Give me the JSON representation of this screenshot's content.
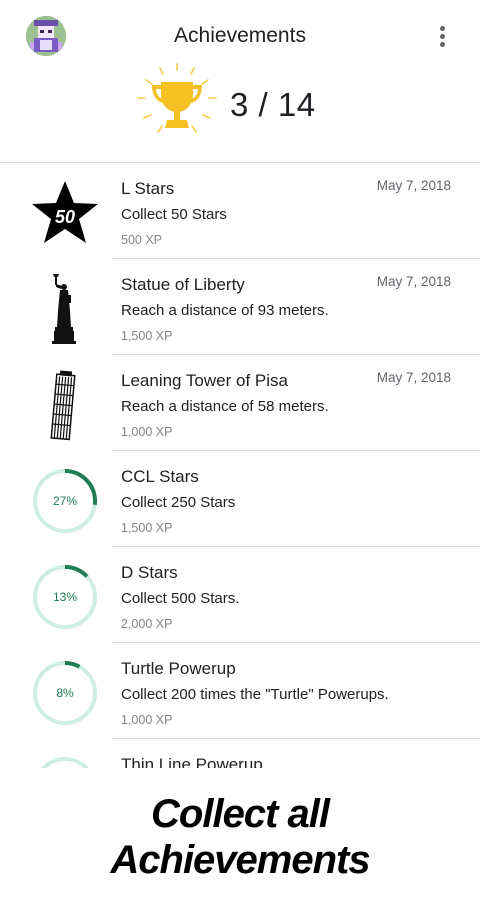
{
  "header": {
    "title": "Achievements",
    "menu_icon": "more-vert-icon",
    "avatar_icon": "avatar"
  },
  "summary": {
    "trophy_icon": "trophy-icon",
    "unlocked": 3,
    "total": 14,
    "text": "3 / 14",
    "accent_color": "#f7c531"
  },
  "achievements": [
    {
      "name": "L Stars",
      "description": "Collect 50 Stars",
      "xp": "500 XP",
      "date": "May 7, 2018",
      "state": "unlocked",
      "icon": "star-50-icon",
      "icon_text": "50"
    },
    {
      "name": "Statue of Liberty",
      "description": "Reach a distance of 93 meters.",
      "xp": "1,500 XP",
      "date": "May 7, 2018",
      "state": "unlocked",
      "icon": "statue-of-liberty-icon"
    },
    {
      "name": "Leaning Tower of Pisa",
      "description": "Reach a distance of 58 meters.",
      "xp": "1,000 XP",
      "date": "May 7, 2018",
      "state": "unlocked",
      "icon": "leaning-tower-icon"
    },
    {
      "name": "CCL Stars",
      "description": "Collect 250 Stars",
      "xp": "1,500 XP",
      "state": "in-progress",
      "progress": 0.27,
      "progress_label": "27%",
      "icon": "progress-ring"
    },
    {
      "name": "D Stars",
      "description": "Collect 500 Stars.",
      "xp": "2,000 XP",
      "state": "in-progress",
      "progress": 0.13,
      "progress_label": "13%",
      "icon": "progress-ring"
    },
    {
      "name": "Turtle Powerup",
      "description": "Collect 200 times the \"Turtle\" Powerups.",
      "xp": "1,000 XP",
      "state": "in-progress",
      "progress": 0.08,
      "progress_label": "8%",
      "icon": "progress-ring"
    },
    {
      "name": "Thin Line Powerup",
      "state": "in-progress",
      "icon": "progress-ring"
    }
  ],
  "caption": {
    "line1": "Collect all",
    "line2": "Achievements"
  },
  "colors": {
    "ring_track": "#cdeee0",
    "ring_fill": "#1e7d55",
    "divider": "#dadce0"
  }
}
